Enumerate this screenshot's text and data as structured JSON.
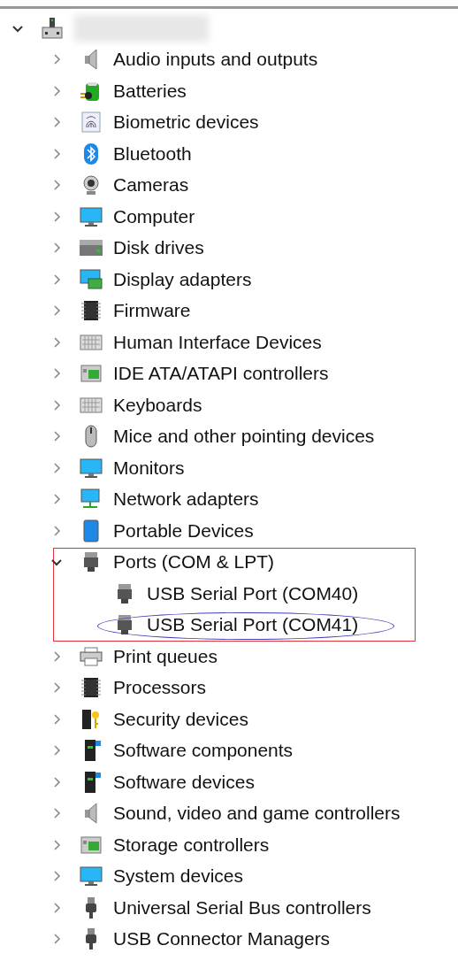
{
  "tree": {
    "root": {
      "kind": "computer",
      "expanded": true,
      "children": [
        {
          "label": "Audio inputs and outputs",
          "kind": "speaker",
          "expanded": false
        },
        {
          "label": "Batteries",
          "kind": "battery",
          "expanded": false
        },
        {
          "label": "Biometric devices",
          "kind": "fingerprint",
          "expanded": false
        },
        {
          "label": "Bluetooth",
          "kind": "bluetooth",
          "expanded": false
        },
        {
          "label": "Cameras",
          "kind": "camera",
          "expanded": false
        },
        {
          "label": "Computer",
          "kind": "monitor",
          "expanded": false
        },
        {
          "label": "Disk drives",
          "kind": "disk",
          "expanded": false
        },
        {
          "label": "Display adapters",
          "kind": "adapter",
          "expanded": false
        },
        {
          "label": "Firmware",
          "kind": "chip",
          "expanded": false
        },
        {
          "label": "Human Interface Devices",
          "kind": "keyboard",
          "expanded": false
        },
        {
          "label": "IDE ATA/ATAPI controllers",
          "kind": "controller",
          "expanded": false
        },
        {
          "label": "Keyboards",
          "kind": "keyboard",
          "expanded": false
        },
        {
          "label": "Mice and other pointing devices",
          "kind": "mouse",
          "expanded": false
        },
        {
          "label": "Monitors",
          "kind": "monitor",
          "expanded": false
        },
        {
          "label": "Network adapters",
          "kind": "network",
          "expanded": false
        },
        {
          "label": "Portable Devices",
          "kind": "tablet",
          "expanded": false
        },
        {
          "label": "Ports (COM & LPT)",
          "kind": "port",
          "expanded": true,
          "highlighted": true,
          "children": [
            {
              "label": "USB Serial Port (COM40)",
              "kind": "port",
              "circled": false
            },
            {
              "label": "USB Serial Port (COM41)",
              "kind": "port",
              "circled": true
            }
          ]
        },
        {
          "label": "Print queues",
          "kind": "printer",
          "expanded": false
        },
        {
          "label": "Processors",
          "kind": "chip",
          "expanded": false
        },
        {
          "label": "Security devices",
          "kind": "key",
          "expanded": false
        },
        {
          "label": "Software components",
          "kind": "tower",
          "expanded": false
        },
        {
          "label": "Software devices",
          "kind": "tower",
          "expanded": false
        },
        {
          "label": "Sound, video and game controllers",
          "kind": "speaker",
          "expanded": false
        },
        {
          "label": "Storage controllers",
          "kind": "controller",
          "expanded": false
        },
        {
          "label": "System devices",
          "kind": "monitor",
          "expanded": false
        },
        {
          "label": "Universal Serial Bus controllers",
          "kind": "usb",
          "expanded": false
        },
        {
          "label": "USB Connector Managers",
          "kind": "usb",
          "expanded": false
        }
      ]
    }
  }
}
